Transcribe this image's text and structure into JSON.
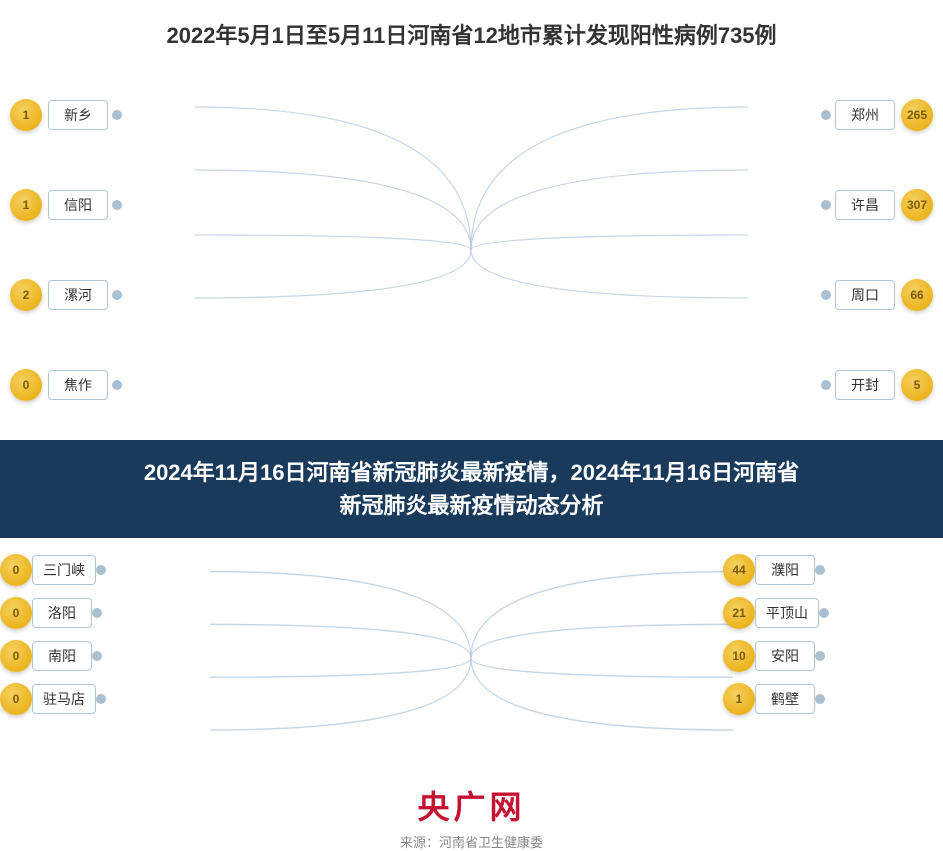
{
  "title": "2022年5月1日至5月11日河南省12地市累计发现阳性病例735例",
  "banner": {
    "line1": "2024年11月16日河南省新冠肺炎最新疫情，2024年11月16日河南省",
    "line2": "新冠肺炎最新疫情动态分析"
  },
  "brand": "央广网",
  "source": "来源：河南省卫生健康委",
  "left_cities": [
    {
      "name": "新乡",
      "count": 1
    },
    {
      "name": "信阳",
      "count": 1
    },
    {
      "name": "漯河",
      "count": 2
    },
    {
      "name": "焦作",
      "count": 0
    }
  ],
  "right_cities": [
    {
      "name": "郑州",
      "count": 265
    },
    {
      "name": "许昌",
      "count": 307
    },
    {
      "name": "周口",
      "count": 66
    },
    {
      "name": "开封",
      "count": 5
    }
  ],
  "bottom_left_cities": [
    {
      "name": "三门峡",
      "count": 0
    },
    {
      "name": "洛阳",
      "count": 0
    },
    {
      "name": "南阳",
      "count": 0
    },
    {
      "name": "驻马店",
      "count": 0
    }
  ],
  "bottom_right_cities": [
    {
      "name": "濮阳",
      "count": 44
    },
    {
      "name": "平顶山",
      "count": 21
    },
    {
      "name": "安阳",
      "count": 10
    },
    {
      "name": "鹤壁",
      "count": 1
    }
  ]
}
